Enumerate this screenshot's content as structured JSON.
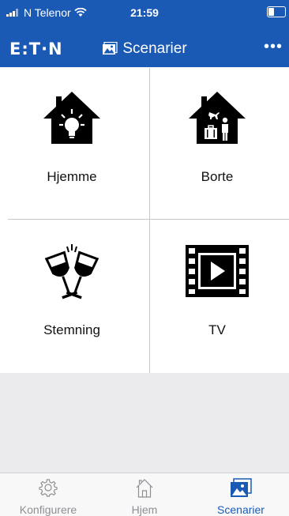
{
  "status_bar": {
    "carrier": "N Telenor",
    "time": "21:59"
  },
  "nav": {
    "logo": "E:T·N",
    "title": "Scenarier",
    "more": "•••"
  },
  "scenes": [
    {
      "label": "Hjemme",
      "icon": "home-lightbulb-icon"
    },
    {
      "label": "Borte",
      "icon": "home-away-icon"
    },
    {
      "label": "Stemning",
      "icon": "wine-glasses-icon"
    },
    {
      "label": "TV",
      "icon": "film-play-icon"
    }
  ],
  "tabs": [
    {
      "label": "Konfigurere",
      "icon": "gear-icon",
      "active": false
    },
    {
      "label": "Hjem",
      "icon": "house-icon",
      "active": false
    },
    {
      "label": "Scenarier",
      "icon": "scenes-icon",
      "active": true
    }
  ],
  "colors": {
    "brand_blue": "#1a5ab4",
    "tab_inactive": "#8e8e93",
    "empty_area": "#ebebed"
  }
}
